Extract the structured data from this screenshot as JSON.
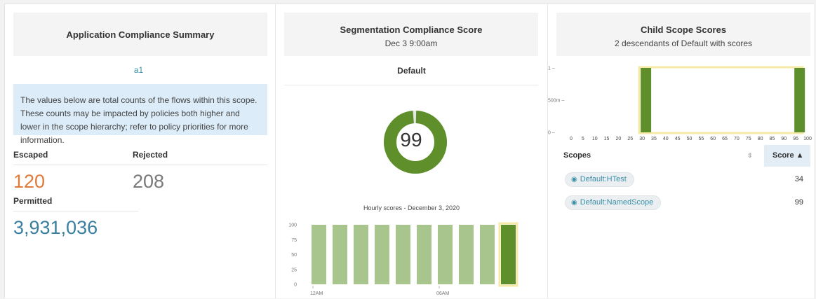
{
  "summary": {
    "title": "Application Compliance Summary",
    "scope_link": "a1",
    "info": "The values below are total counts of the flows within this scope. These counts may be impacted by policies both higher and lower in the scope hierarchy; refer to policy priorities for more information.",
    "escaped_label": "Escaped",
    "escaped_value": "120",
    "rejected_label": "Rejected",
    "rejected_value": "208",
    "permitted_label": "Permitted",
    "permitted_value": "3,931,036",
    "colors": {
      "escaped": "#e07b39",
      "rejected": "#7a7a7a",
      "permitted": "#3a7fa0"
    }
  },
  "segmentation": {
    "title": "Segmentation Compliance Score",
    "subtitle": "Dec 3 9:00am",
    "scope": "Default",
    "score": "99",
    "score_fraction": 0.99,
    "hourly_title": "Hourly scores - December 3, 2020",
    "colors": {
      "ring": "#5e8f2a",
      "bar": "#a9c58e",
      "bar_selected": "#5e8f2a",
      "highlight": "#f4e9a6"
    }
  },
  "chart_data": [
    {
      "type": "bar",
      "title": "Hourly scores - December 3, 2020",
      "categories": [
        "12AM",
        "",
        "",
        "",
        "",
        "",
        "06AM",
        "",
        "",
        ""
      ],
      "values": [
        100,
        100,
        100,
        100,
        100,
        100,
        100,
        100,
        100,
        100
      ],
      "y_ticks": [
        "100",
        "75",
        "50",
        "25",
        "0"
      ],
      "ylim": [
        0,
        100
      ],
      "x_tick_labels": [
        "12AM",
        "06AM"
      ],
      "selected_index": 9
    },
    {
      "type": "bar",
      "title": "",
      "x": [
        30,
        95
      ],
      "values": [
        1,
        1
      ],
      "x_ticks": [
        "0",
        "5",
        "10",
        "15",
        "20",
        "25",
        "30",
        "35",
        "40",
        "45",
        "50",
        "55",
        "60",
        "65",
        "70",
        "75",
        "80",
        "85",
        "90",
        "95",
        "100"
      ],
      "y_ticks": [
        "1 –",
        "500m –",
        "0 –"
      ],
      "xlim": [
        0,
        100
      ],
      "ylim": [
        0,
        1
      ],
      "highlight_range": [
        30,
        95
      ]
    }
  ],
  "child_scopes": {
    "title": "Child Scope Scores",
    "subtitle": "2 descendants of Default with scores",
    "col_scopes": "Scopes",
    "col_score": "Score ▲",
    "sort_icon": "⇳",
    "rows": [
      {
        "name": "Default:HTest",
        "score": "34"
      },
      {
        "name": "Default:NamedScope",
        "score": "99"
      }
    ],
    "colors": {
      "bar": "#5e8f2a",
      "highlight": "#f4e9a6"
    }
  }
}
